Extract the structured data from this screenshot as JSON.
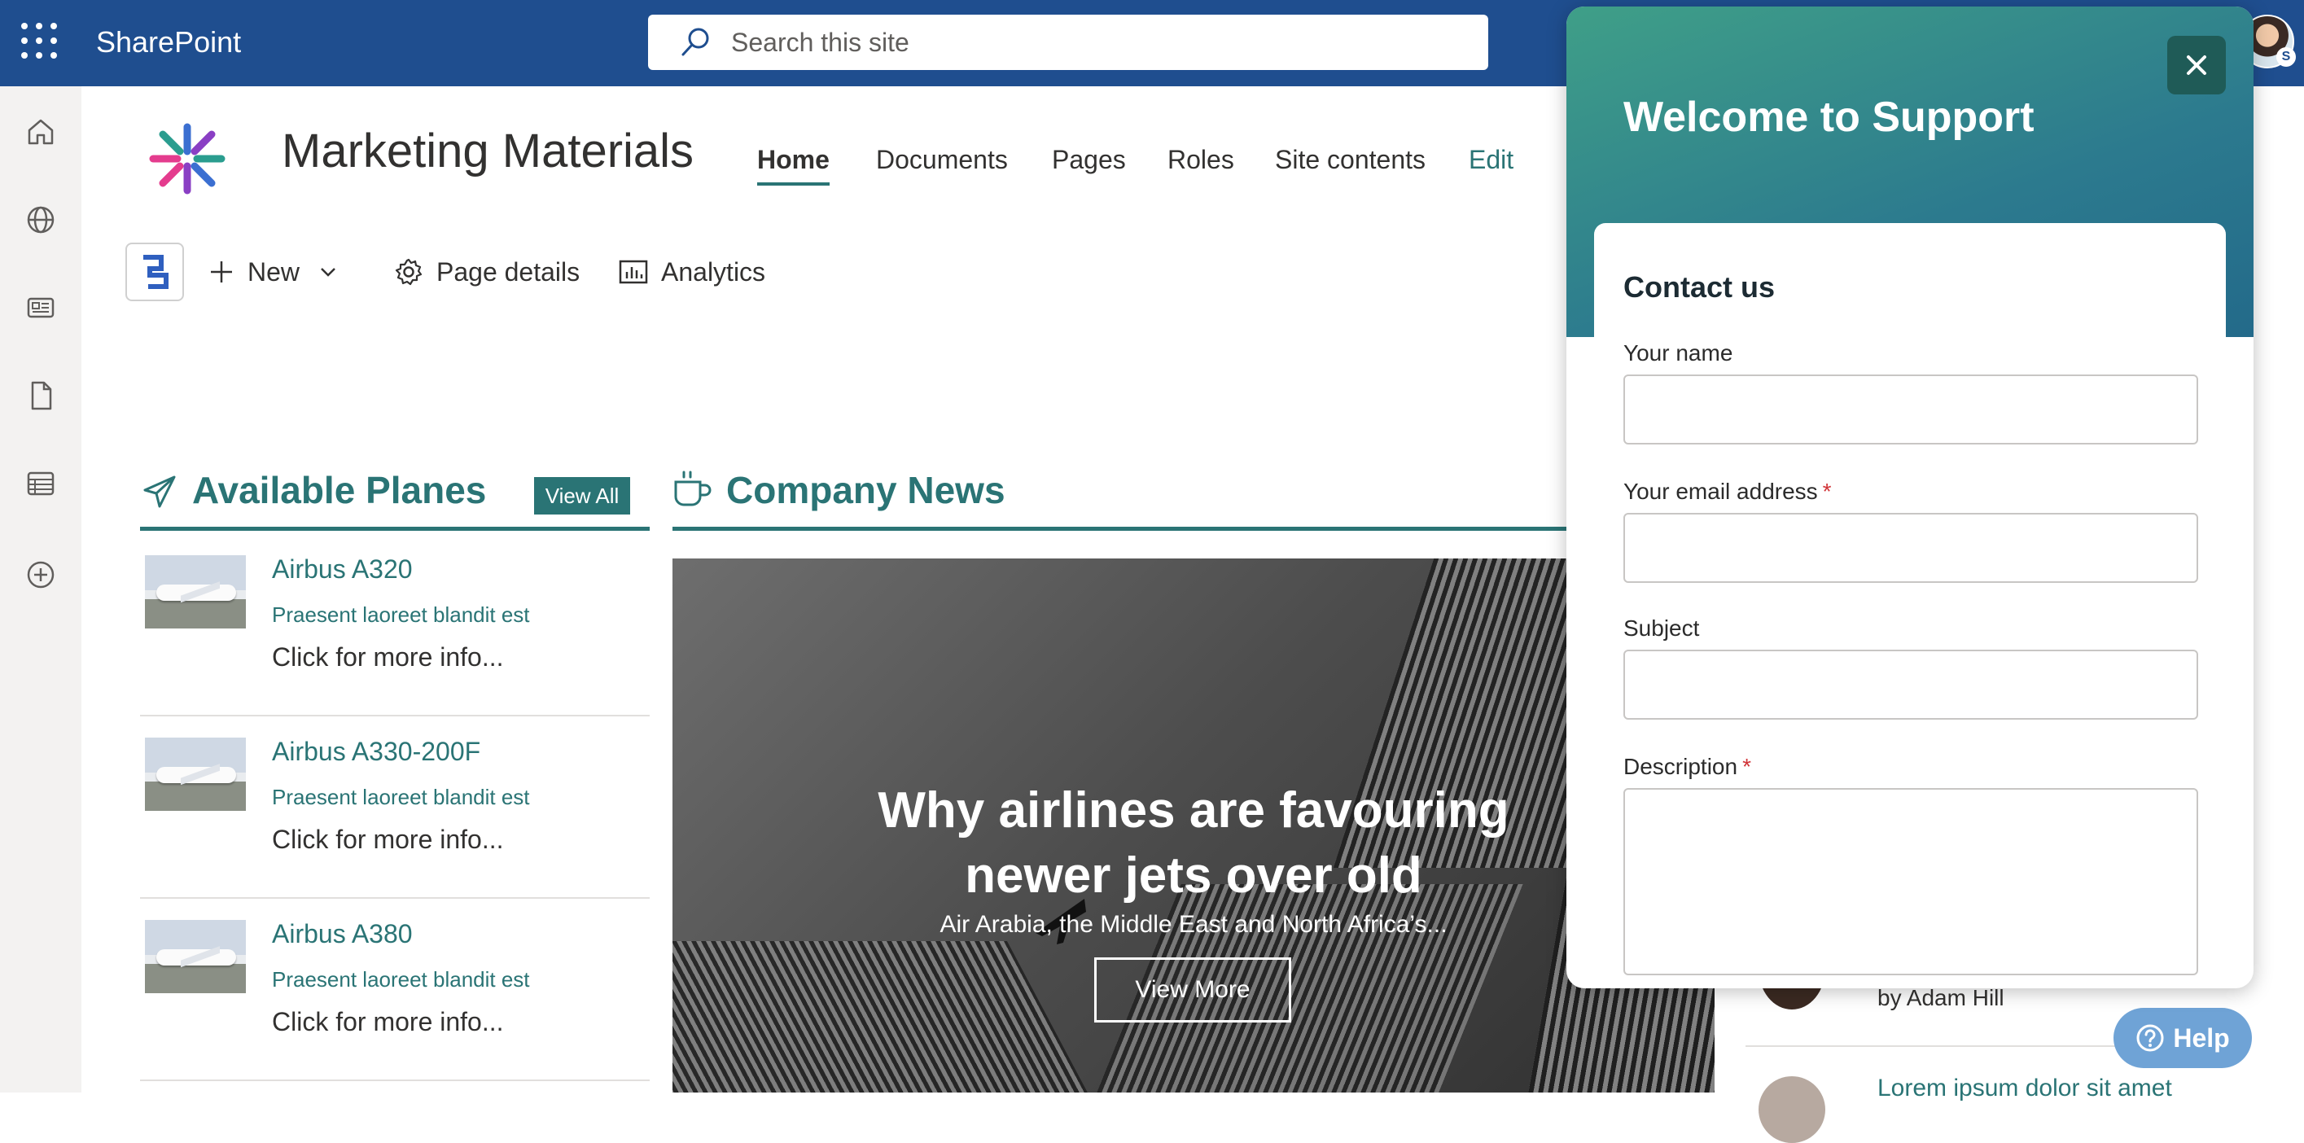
{
  "app": {
    "name": "SharePoint"
  },
  "search": {
    "placeholder": "Search this site"
  },
  "user": {
    "badge": "S"
  },
  "site": {
    "title": "Marketing Materials",
    "nav": [
      {
        "label": "Home"
      },
      {
        "label": "Documents"
      },
      {
        "label": "Pages"
      },
      {
        "label": "Roles"
      },
      {
        "label": "Site contents"
      },
      {
        "label": "Edit"
      }
    ]
  },
  "commandbar": {
    "new_label": "New",
    "page_details_label": "Page details",
    "analytics_label": "Analytics"
  },
  "rail": {
    "icons": [
      "home-icon",
      "globe-icon",
      "news-icon",
      "file-icon",
      "list-icon",
      "add-circle-icon"
    ]
  },
  "planes": {
    "title": "Available Planes",
    "view_all": "View All",
    "items": [
      {
        "name": "Airbus A320",
        "desc": "Praesent laoreet blandit est",
        "more": "Click for more info..."
      },
      {
        "name": "Airbus A330-200F",
        "desc": "Praesent laoreet blandit est",
        "more": "Click for more info..."
      },
      {
        "name": "Airbus A380",
        "desc": "Praesent laoreet blandit est",
        "more": "Click for more info..."
      }
    ]
  },
  "news": {
    "title": "Company News",
    "hero": {
      "title_line1": "Why airlines are favouring",
      "title_line2": "newer jets over old",
      "subtitle": "Air Arabia, the Middle East and North Africa’s...",
      "button": "View More"
    },
    "byline": "by Adam Hill",
    "next_link": "Lorem ipsum dolor sit amet"
  },
  "help": {
    "label": "Help"
  },
  "support": {
    "title": "Welcome to Support",
    "form_title": "Contact us",
    "fields": {
      "name": "Your name",
      "email": "Your email address",
      "subject": "Subject",
      "description": "Description"
    },
    "required_mark": "*"
  },
  "colors": {
    "suite_bar": "#1f4e8f",
    "accent": "#2a7475",
    "panel_gradient_start": "#3f9f88",
    "panel_gradient_end": "#236a8a",
    "required": "#d13438"
  }
}
